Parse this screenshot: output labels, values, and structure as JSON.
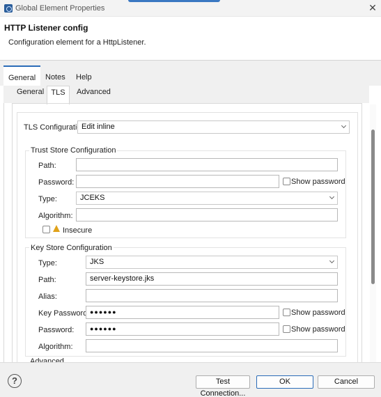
{
  "window": {
    "title": "Global Element Properties"
  },
  "header": {
    "title": "HTTP Listener config",
    "description": "Configuration element for a HttpListener."
  },
  "tabs": [
    {
      "label": "General",
      "selected": true
    },
    {
      "label": "Notes",
      "selected": false
    },
    {
      "label": "Help",
      "selected": false
    }
  ],
  "subtabs": [
    {
      "label": "General",
      "selected": false
    },
    {
      "label": "TLS",
      "selected": true
    },
    {
      "label": "Advanced",
      "selected": false
    }
  ],
  "tls": {
    "config_label": "TLS Configuration",
    "config_value": "Edit inline"
  },
  "trust_store": {
    "title": "Trust Store Configuration",
    "path_label": "Path:",
    "path_value": "",
    "password_label": "Password:",
    "password_value": "",
    "show_password_label": "Show password",
    "type_label": "Type:",
    "type_value": "JCEKS",
    "algorithm_label": "Algorithm:",
    "algorithm_value": "",
    "insecure_label": "Insecure"
  },
  "key_store": {
    "title": "Key Store Configuration",
    "type_label": "Type:",
    "type_value": "JKS",
    "path_label": "Path:",
    "path_value": "server-keystore.jks",
    "alias_label": "Alias:",
    "alias_value": "",
    "key_password_label": "Key Password:",
    "key_password_value": "●●●●●●",
    "key_show_password_label": "Show password",
    "password_label": "Password:",
    "password_value": "●●●●●●",
    "show_password_label": "Show password",
    "algorithm_label": "Algorithm:",
    "algorithm_value": ""
  },
  "advanced_section_label": "Advanced",
  "footer": {
    "help_glyph": "?",
    "test_connection_label": "Test Connection...",
    "ok_label": "OK",
    "cancel_label": "Cancel"
  },
  "colors": {
    "accent": "#2b6cb8",
    "warning": "#e0a21a"
  }
}
